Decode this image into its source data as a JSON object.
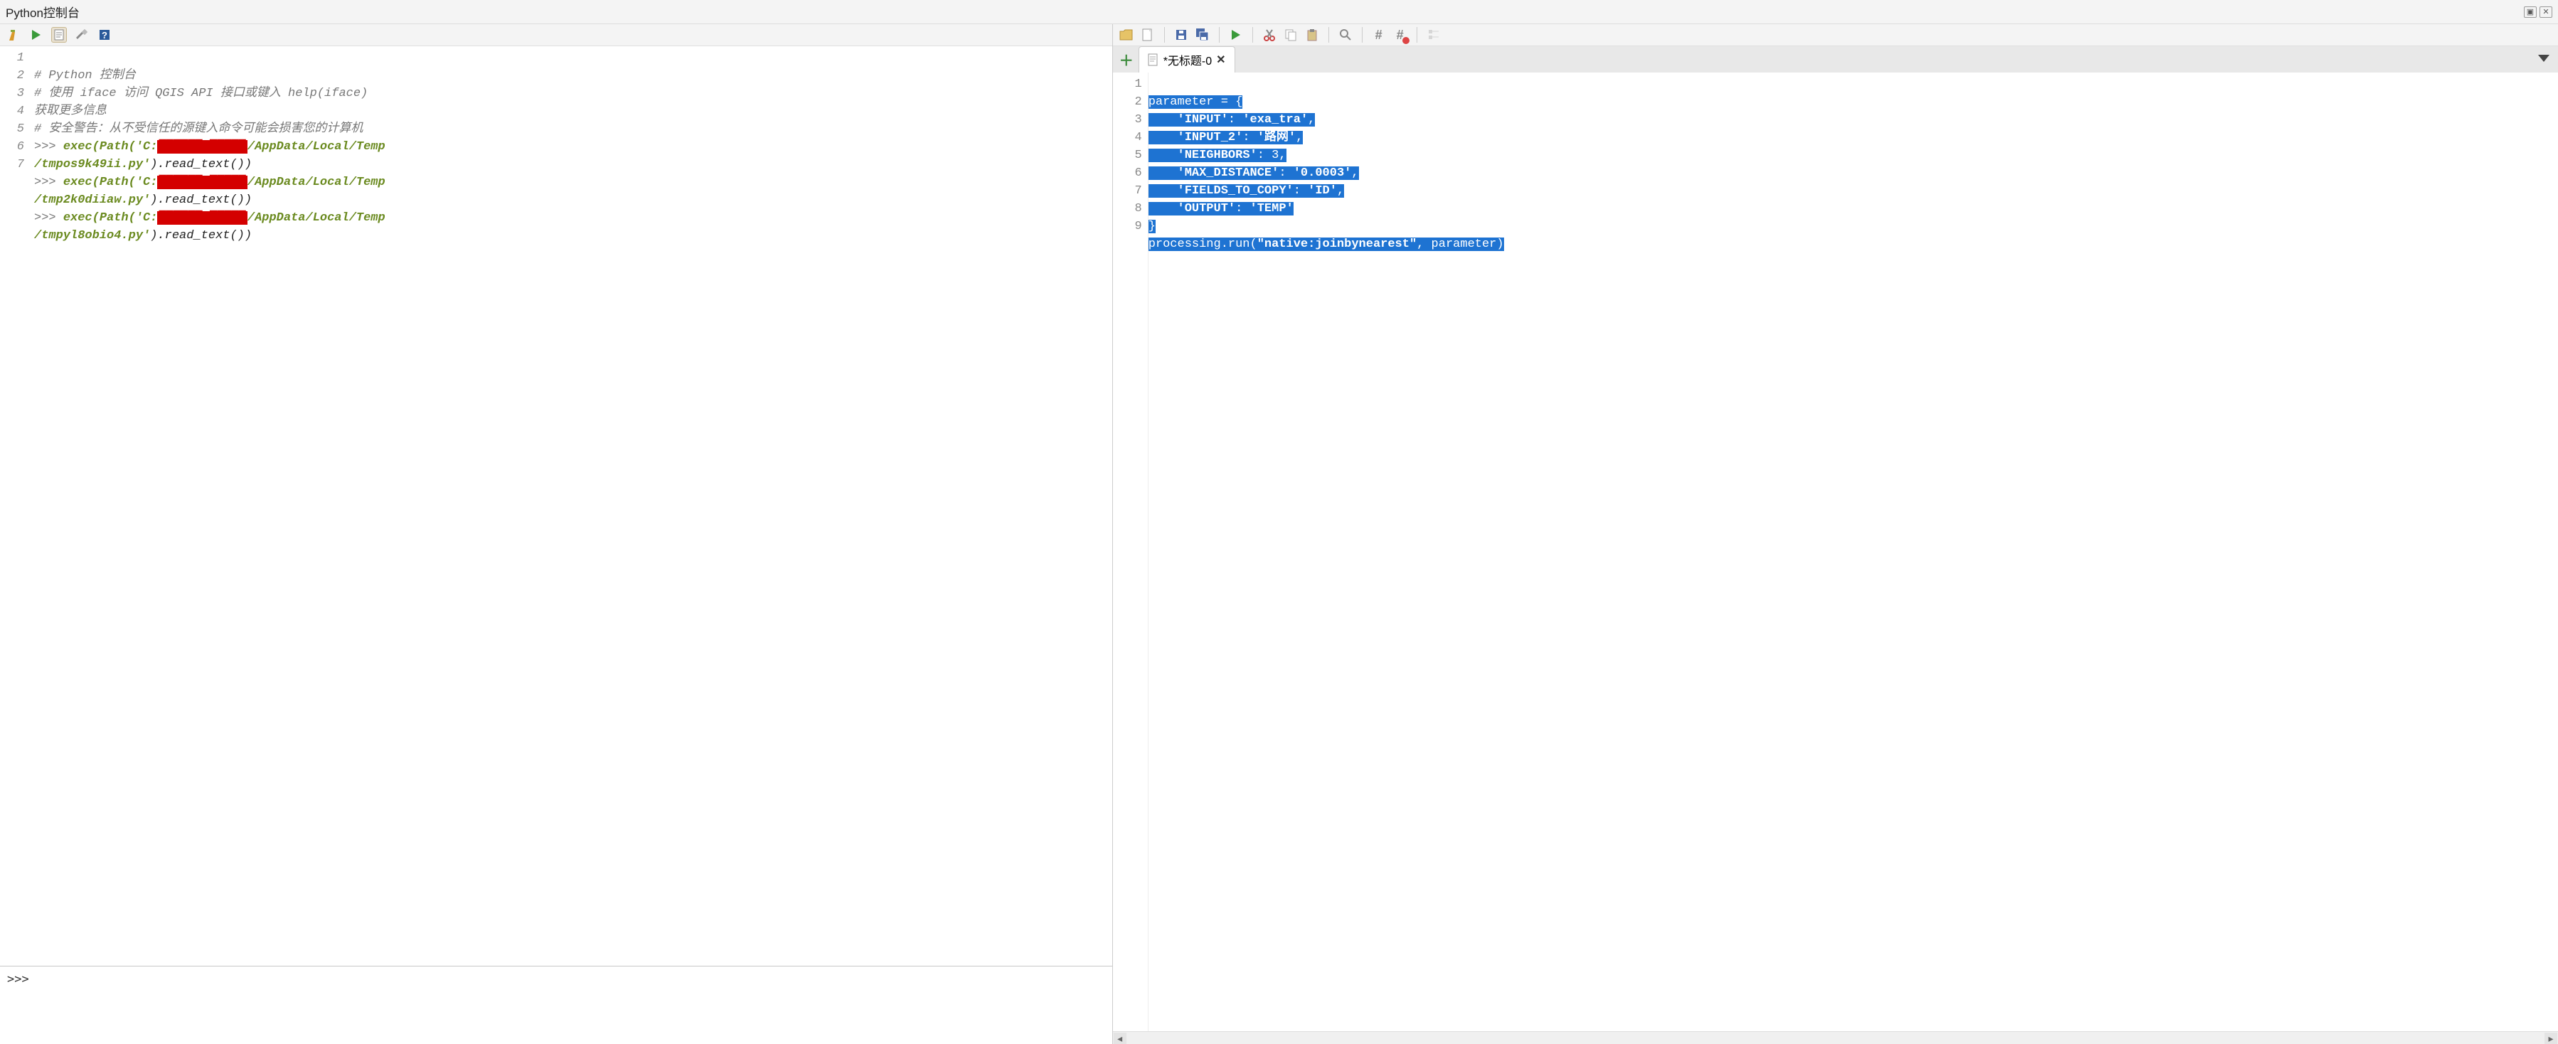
{
  "titlebar": {
    "title": "Python控制台"
  },
  "left_toolbar": {
    "clear_icon": "clear",
    "run_icon": "run",
    "show_editor_icon": "editor",
    "settings_icon": "settings",
    "help_icon": "help"
  },
  "right_toolbar": {
    "open_icon": "open",
    "new_icon": "new",
    "save_icon": "save",
    "saveas_icon": "saveas",
    "run_icon": "run",
    "cut_icon": "cut",
    "copy_icon": "copy",
    "paste_icon": "paste",
    "find_icon": "find",
    "comment_icon": "comment",
    "uncomment_icon": "uncomment",
    "objinspect_icon": "objinspect"
  },
  "console": {
    "gutter": [
      "1",
      "2",
      "",
      "3",
      "4",
      "",
      "5",
      "",
      "6",
      "",
      "7"
    ],
    "lines": {
      "l1": "# Python 控制台",
      "l2a": "# 使用 iface 访问 QGIS API 接口或键入 help(iface) ",
      "l2b": "获取更多信息",
      "l3": "# 安全警告：从不受信任的源键入命令可能会损害您的计算机",
      "l4_prompt": ">>> ",
      "l4_a": "exec(Path(",
      "l4_s1": "'C:",
      "l4_red": "██████/█████",
      "l4_s2": "/AppData/Local/Temp",
      "l4_s3": "/tmpos9k49ii.py'",
      "l4_b": ").read_text())",
      "l5_prompt": ">>> ",
      "l5_a": "exec(Path(",
      "l5_s1": "'C:",
      "l5_red": "██████/█████",
      "l5_s2": "/AppData/Local/Temp",
      "l5_s3": "/tmp2k0diiaw.py'",
      "l5_b": ").read_text())",
      "l6_prompt": ">>> ",
      "l6_a": "exec(Path(",
      "l6_s1": "'C:",
      "l6_red": "██████/█████",
      "l6_s2": "/AppData/Local/Temp",
      "l6_s3": "/tmpyl8obio4.py'",
      "l6_b": ").read_text())"
    },
    "input_prompt": ">>>"
  },
  "editor": {
    "tab_label": "*无标题-0",
    "gutter": [
      "1",
      "2",
      "3",
      "4",
      "5",
      "6",
      "7",
      "8",
      "9"
    ],
    "code": {
      "l1": "parameter = {",
      "l2a": "    ",
      "l2k": "'INPUT'",
      "l2m": ": ",
      "l2v": "'exa_tra'",
      "l2e": ",",
      "l3a": "    ",
      "l3k": "'INPUT_2'",
      "l3m": ": ",
      "l3v": "'路网'",
      "l3e": ",",
      "l4a": "    ",
      "l4k": "'NEIGHBORS'",
      "l4m": ": 3,",
      "l5a": "    ",
      "l5k": "'MAX_DISTANCE'",
      "l5m": ": ",
      "l5v": "'0.0003'",
      "l5e": ",",
      "l6a": "    ",
      "l6k": "'FIELDS_TO_COPY'",
      "l6m": ": ",
      "l6v": "'ID'",
      "l6e": ",",
      "l7a": "    ",
      "l7k": "'OUTPUT'",
      "l7m": ": ",
      "l7v": "'TEMP'",
      "l8": "}",
      "l9a": "processing.run(",
      "l9s": "\"native:joinbynearest\"",
      "l9b": ", parameter)"
    }
  }
}
